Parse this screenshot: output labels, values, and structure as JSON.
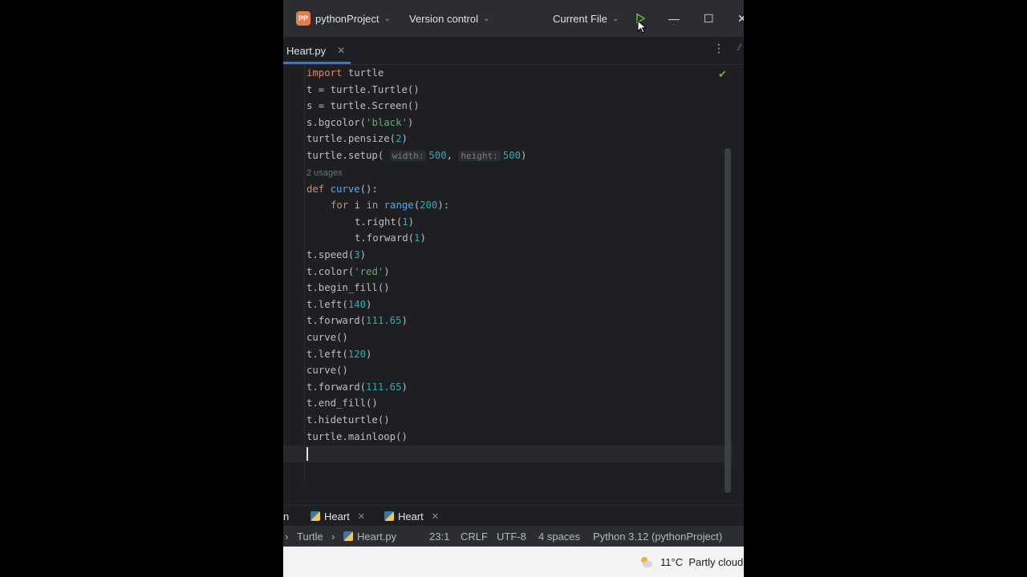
{
  "titlebar": {
    "project_badge": "PP",
    "project_name": "pythonProject",
    "vcs": "Version control",
    "run_config": "Current File",
    "run_icon": "play-icon",
    "minimize": "—",
    "maximize": "☐",
    "close": "✕"
  },
  "tab": {
    "label": "Heart.py",
    "close": "✕"
  },
  "kebab": "⋮",
  "code": {
    "l1": [
      "import",
      "turtle"
    ],
    "l2": "t = turtle.Turtle()",
    "l3": "s = turtle.Screen()",
    "l4_a": "s.bgcolor(",
    "l4_s": "'black'",
    "l4_b": ")",
    "l5_a": "turtle.pensize(",
    "l5_n": "2",
    "l5_b": ")",
    "l6_a": "turtle.setup(",
    "l6_h1": "width:",
    "l6_n1": "500",
    "l6_c": ",",
    "l6_h2": "height:",
    "l6_n2": "500",
    "l6_b": ")",
    "usages": "2 usages",
    "l7_kw": "def",
    "l7_fn": "curve",
    "l7_b": "():",
    "l8_kw1": "for",
    "l8_i": "i",
    "l8_kw2": "in",
    "l8_fn": "range",
    "l8_a": "(",
    "l8_n": "200",
    "l8_b": "):",
    "l9_a": "t.right(",
    "l9_n": "1",
    "l9_b": ")",
    "l10_a": "t.forward(",
    "l10_n": "1",
    "l10_b": ")",
    "l11_a": "t.speed(",
    "l11_n": "3",
    "l11_b": ")",
    "l12_a": "t.color(",
    "l12_s": "'red'",
    "l12_b": ")",
    "l13": "t.begin_fill()",
    "l14_a": "t.left(",
    "l14_n": "140",
    "l14_b": ")",
    "l15_a": "t.forward(",
    "l15_n": "111.65",
    "l15_b": ")",
    "l16": "curve()",
    "l17_a": "t.left(",
    "l17_n": "120",
    "l17_b": ")",
    "l18": "curve()",
    "l19_a": "t.forward(",
    "l19_n": "111.65",
    "l19_b": ")",
    "l20": "t.end_fill()",
    "l21": "t.hideturtle()",
    "l22": "turtle.mainloop()"
  },
  "runbar": {
    "left_fragment": "n",
    "tab1": "Heart",
    "tab2": "Heart",
    "close": "✕"
  },
  "statusbar": {
    "crumb1": "Turtle",
    "crumb_sep": "›",
    "crumb2": "Heart.py",
    "position": "23:1",
    "line_sep": "CRLF",
    "encoding": "UTF-8",
    "indent": "4 spaces",
    "interpreter": "Python 3.12 (pythonProject)"
  },
  "taskbar": {
    "temperature": "11°C",
    "weather": "Partly cloud"
  },
  "colors": {
    "keyword": "#cf8e6d",
    "function": "#56a8f5",
    "number": "#2aacb8",
    "string": "#6aab73",
    "accent": "#3574f0",
    "run": "#5fb832"
  }
}
